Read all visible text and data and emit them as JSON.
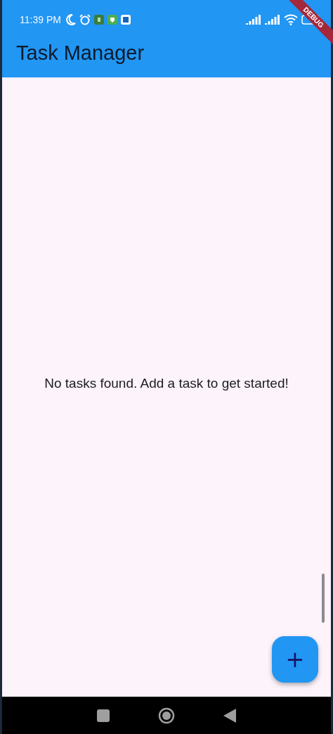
{
  "status_bar": {
    "time": "11:39 PM"
  },
  "debug_banner": "DEBUG",
  "app_bar": {
    "title": "Task Manager"
  },
  "empty_message": "No tasks found. Add a task to get started!",
  "fab": {
    "label": "+"
  }
}
